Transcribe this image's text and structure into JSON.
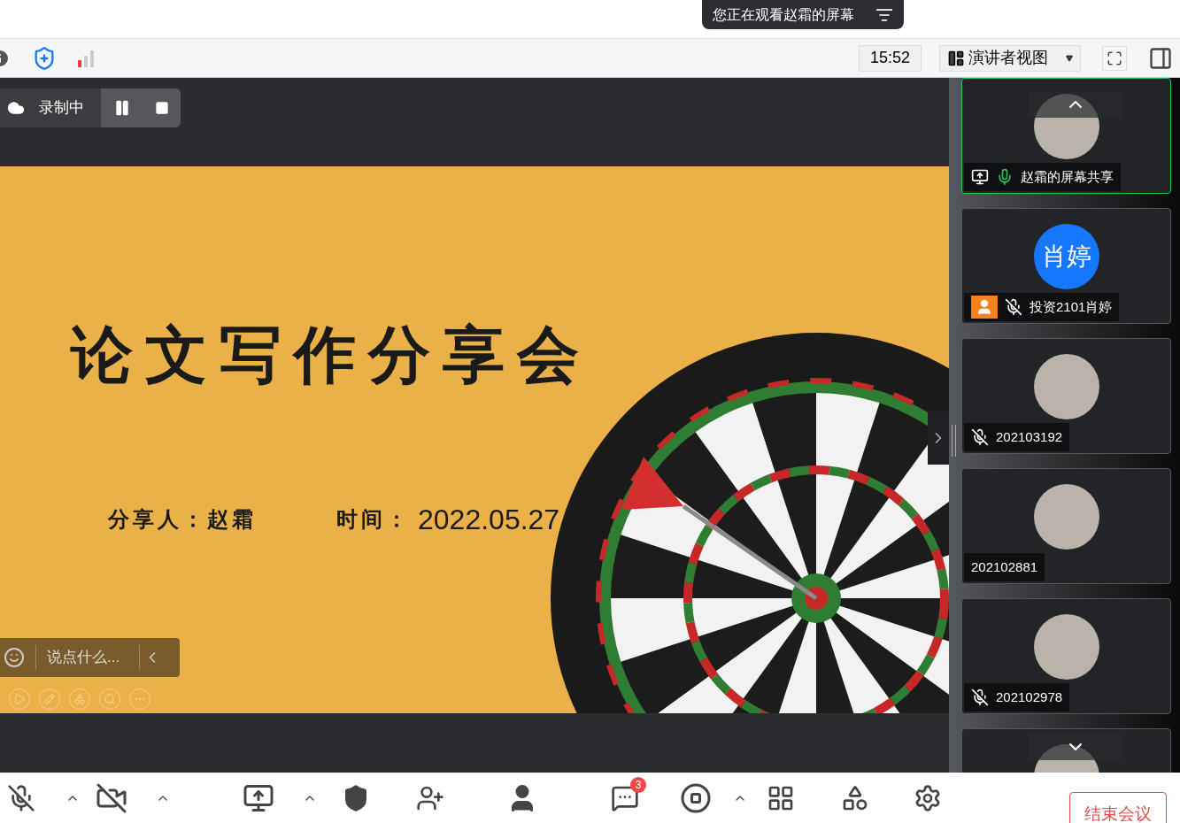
{
  "banner": {
    "text": "您正在观看赵霜的屏幕"
  },
  "toolbar": {
    "time": "15:52",
    "view": "演讲者视图"
  },
  "recording": {
    "label": "录制中",
    "paused": false
  },
  "slide": {
    "title": "论文写作分享会",
    "speaker": "分享人：赵霜",
    "time_label": "时间：",
    "date": "2022.05.27"
  },
  "chat_input": {
    "placeholder": "说点什么..."
  },
  "participants": [
    {
      "name": "赵霜的屏幕共享",
      "kind": "photo",
      "selected": true,
      "sharing": true,
      "host": false,
      "mic_on": true,
      "muted": false
    },
    {
      "name": "投资2101肖婷",
      "kind": "initials",
      "initials": "肖婷",
      "selected": false,
      "sharing": false,
      "host": true,
      "mic_on": false,
      "muted": true
    },
    {
      "name": "202103192",
      "kind": "photo",
      "selected": false,
      "sharing": false,
      "host": false,
      "mic_on": false,
      "muted": true
    },
    {
      "name": "202102881",
      "kind": "photo",
      "selected": false,
      "sharing": false,
      "host": false,
      "mic_on": false,
      "muted": false
    },
    {
      "name": "202102978",
      "kind": "photo",
      "selected": false,
      "sharing": false,
      "host": false,
      "mic_on": false,
      "muted": true
    },
    {
      "kind": "photo",
      "selected": false
    }
  ],
  "bottom_bar": {
    "chat_badge": "3",
    "end_button": "结束会议"
  }
}
